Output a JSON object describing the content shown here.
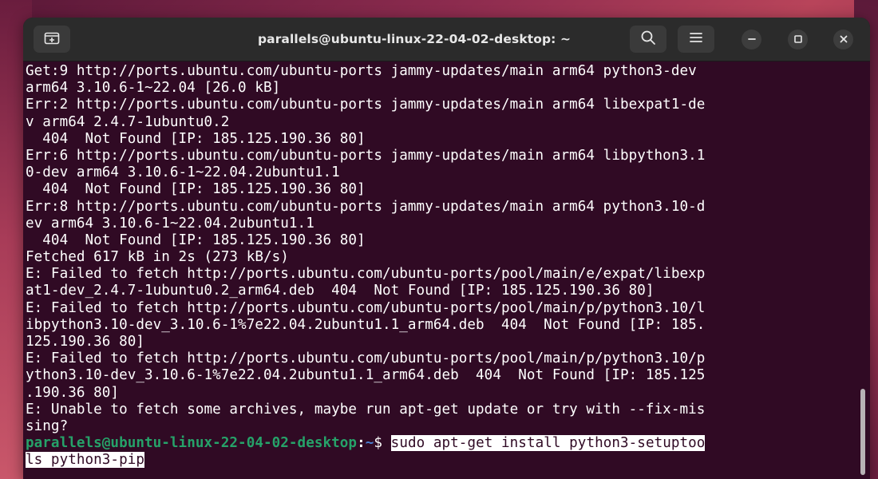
{
  "window": {
    "title": "parallels@ubuntu-linux-22-04-02-desktop: ~"
  },
  "icons": {
    "new_tab": "new-tab-icon",
    "search": "search-icon",
    "menu": "hamburger-menu-icon",
    "minimize": "minimize-icon",
    "maximize": "maximize-icon",
    "close": "close-icon"
  },
  "colors": {
    "terminal_bg": "#300a24",
    "prompt_user": "#26a269",
    "prompt_path": "#4a7fd0",
    "titlebar_bg": "#2b2b2b"
  },
  "terminal": {
    "output_lines": [
      "Get:9 http://ports.ubuntu.com/ubuntu-ports jammy-updates/main arm64 python3-dev",
      "arm64 3.10.6-1~22.04 [26.0 kB]",
      "Err:2 http://ports.ubuntu.com/ubuntu-ports jammy-updates/main arm64 libexpat1-de",
      "v arm64 2.4.7-1ubuntu0.2",
      "  404  Not Found [IP: 185.125.190.36 80]",
      "Err:6 http://ports.ubuntu.com/ubuntu-ports jammy-updates/main arm64 libpython3.1",
      "0-dev arm64 3.10.6-1~22.04.2ubuntu1.1",
      "  404  Not Found [IP: 185.125.190.36 80]",
      "Err:8 http://ports.ubuntu.com/ubuntu-ports jammy-updates/main arm64 python3.10-d",
      "ev arm64 3.10.6-1~22.04.2ubuntu1.1",
      "  404  Not Found [IP: 185.125.190.36 80]",
      "Fetched 617 kB in 2s (273 kB/s)",
      "E: Failed to fetch http://ports.ubuntu.com/ubuntu-ports/pool/main/e/expat/libexp",
      "at1-dev_2.4.7-1ubuntu0.2_arm64.deb  404  Not Found [IP: 185.125.190.36 80]",
      "E: Failed to fetch http://ports.ubuntu.com/ubuntu-ports/pool/main/p/python3.10/l",
      "ibpython3.10-dev_3.10.6-1%7e22.04.2ubuntu1.1_arm64.deb  404  Not Found [IP: 185.",
      "125.190.36 80]",
      "E: Failed to fetch http://ports.ubuntu.com/ubuntu-ports/pool/main/p/python3.10/p",
      "ython3.10-dev_3.10.6-1%7e22.04.2ubuntu1.1_arm64.deb  404  Not Found [IP: 185.125",
      ".190.36 80]",
      "E: Unable to fetch some archives, maybe run apt-get update or try with --fix-mis",
      "sing?"
    ],
    "prompt": {
      "user_host": "parallels@ubuntu-linux-22-04-02-desktop",
      "separator": ":",
      "path": "~",
      "dollar": "$ ",
      "command_part1": "sudo apt-get install python3-setuptoo",
      "command_part2": "ls python3-pip"
    }
  }
}
